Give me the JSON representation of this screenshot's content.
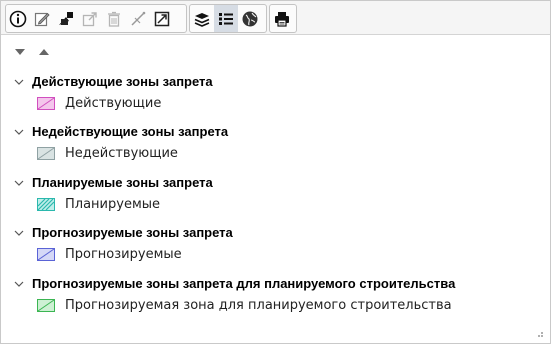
{
  "toolbar": {
    "groups": [
      {
        "buttons": [
          {
            "icon": "info-icon",
            "active": false
          },
          {
            "icon": "edit-icon",
            "active": false
          },
          {
            "icon": "style-icon",
            "active": false
          },
          {
            "icon": "export-icon",
            "active": false
          },
          {
            "icon": "delete-icon",
            "active": false
          },
          {
            "icon": "measure-icon",
            "active": false
          },
          {
            "icon": "zoom-to-icon",
            "active": false
          }
        ]
      },
      {
        "buttons": [
          {
            "icon": "layers-icon",
            "active": false
          },
          {
            "icon": "legend-icon",
            "active": true
          },
          {
            "icon": "globe-icon",
            "active": false
          }
        ]
      },
      {
        "buttons": [
          {
            "icon": "print-icon",
            "active": false
          }
        ]
      }
    ]
  },
  "legend": {
    "groups": [
      {
        "title": "Действующие зоны запрета",
        "layer": "Действующие",
        "swatch": {
          "fill": "#f4c6ec",
          "stroke": "#d14fbf",
          "pattern": "diagonal"
        }
      },
      {
        "title": "Недействующие зоны запрета",
        "layer": "Недействующие",
        "swatch": {
          "fill": "#d9e3e3",
          "stroke": "#8fa1a3",
          "pattern": "diagonal"
        }
      },
      {
        "title": "Планируемые зоны запрета",
        "layer": "Планируемые",
        "swatch": {
          "fill": "#bfeeea",
          "stroke": "#2bb8ad",
          "pattern": "hatch"
        }
      },
      {
        "title": "Прогнозируемые зоны запрета",
        "layer": "Прогнозируемые",
        "swatch": {
          "fill": "#d5d8f7",
          "stroke": "#5a63d6",
          "pattern": "diagonal"
        }
      },
      {
        "title": "Прогнозируемые зоны запрета для планируемого строительства",
        "layer": "Прогнозируемая зона для планируемого строительства",
        "swatch": {
          "fill": "#cdf0d3",
          "stroke": "#3bb552",
          "pattern": "diagonal"
        }
      }
    ]
  }
}
